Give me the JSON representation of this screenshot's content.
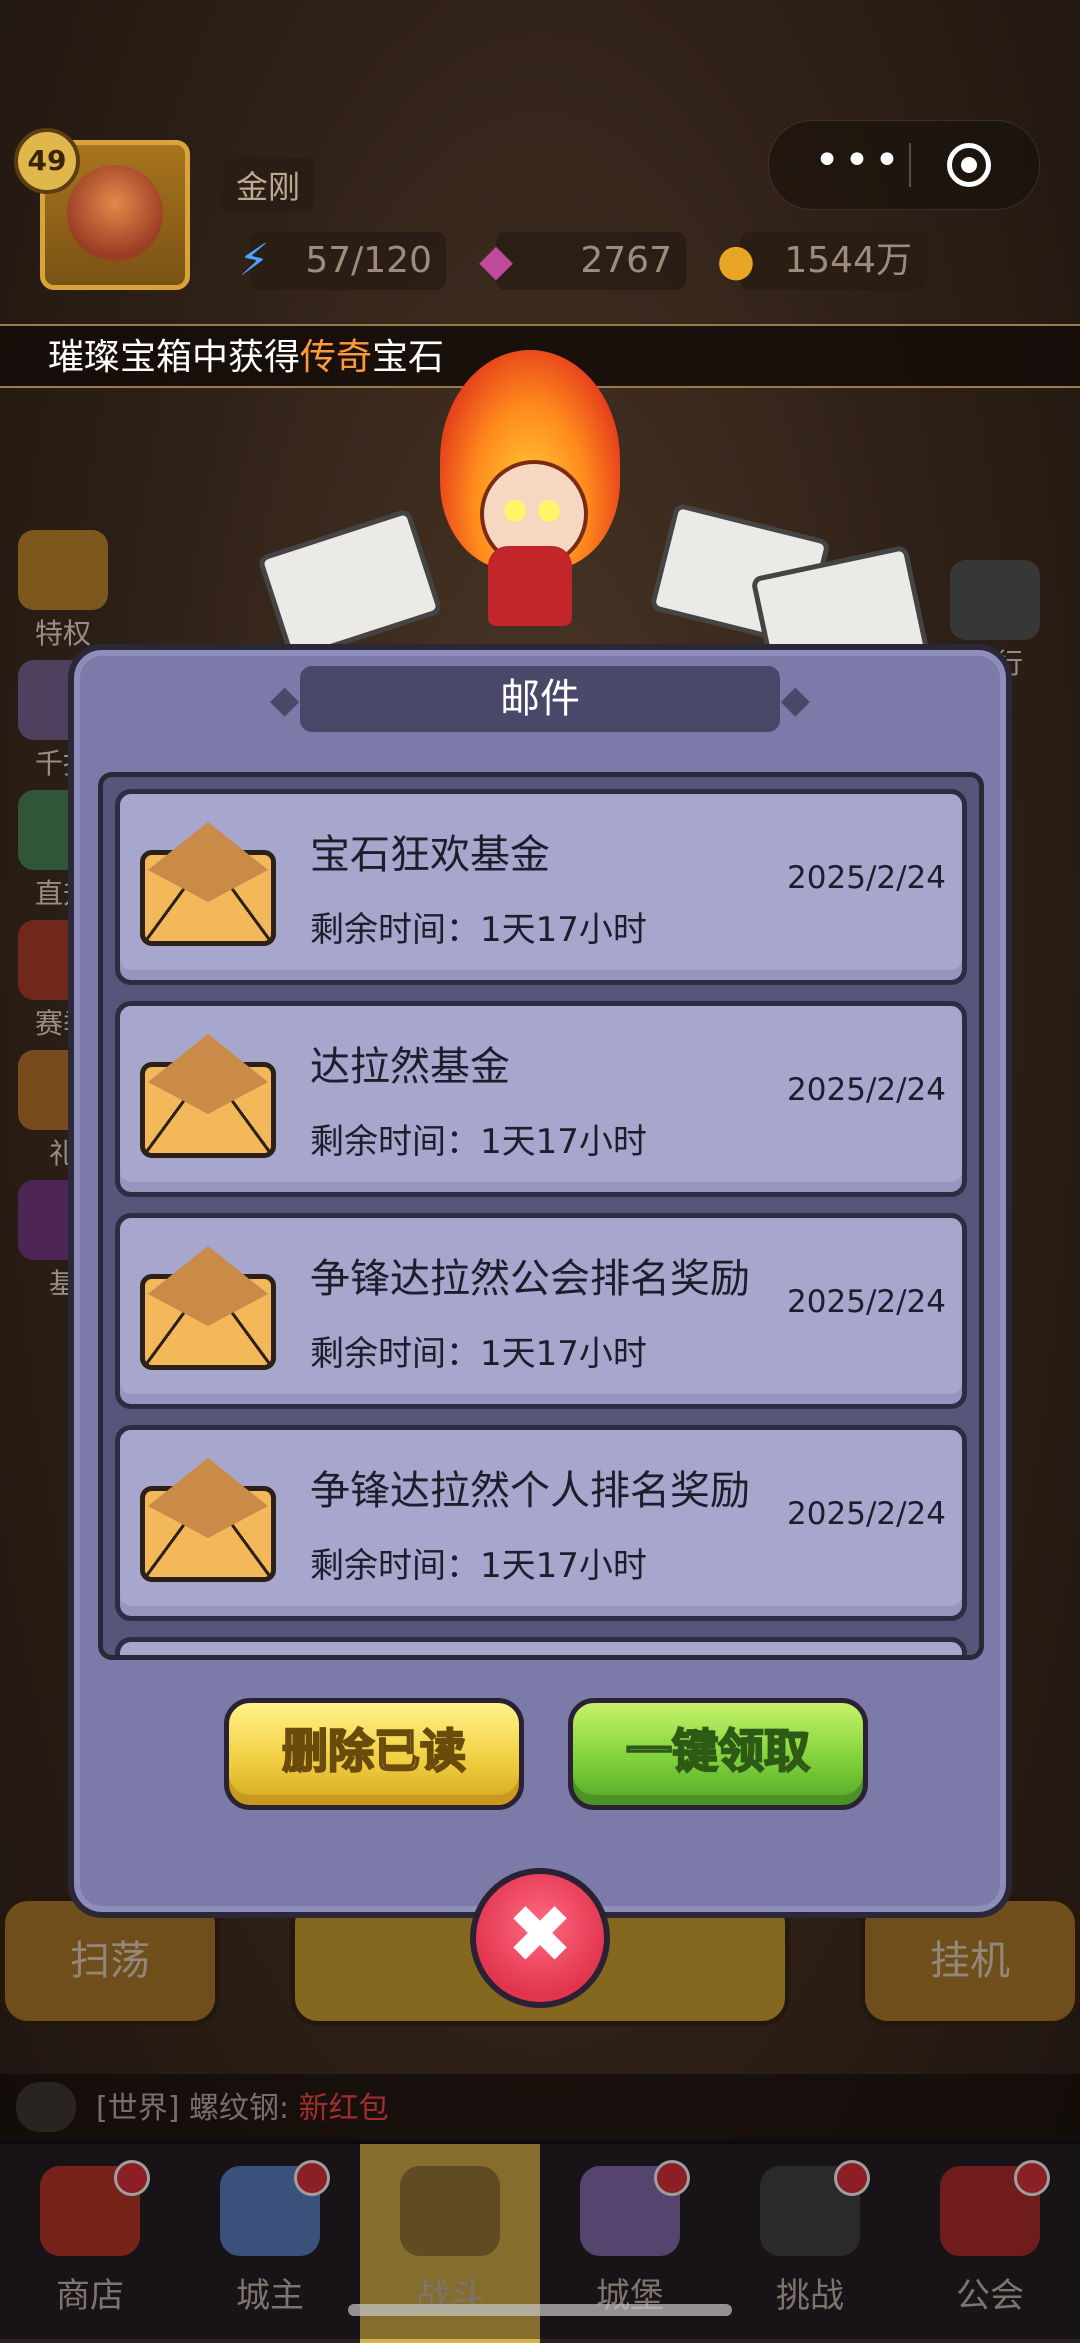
{
  "player": {
    "level": "49",
    "name": "金刚"
  },
  "resources": [
    {
      "icon": "lightning-icon",
      "value": "57/120"
    },
    {
      "icon": "gem-icon",
      "value": "2767"
    },
    {
      "icon": "coin-icon",
      "value": "1544万"
    }
  ],
  "ticker": {
    "prefix": "璀璨宝箱中获得",
    "highlight": "传奇",
    "suffix": "宝石"
  },
  "left_menu": [
    "特权",
    "千抽",
    "直升",
    "赛季",
    "礼",
    "基"
  ],
  "right_menu": [
    "排行"
  ],
  "modal": {
    "title": "邮件",
    "mails": [
      {
        "title": "宝石狂欢基金",
        "time": "剩余时间：1天17小时",
        "date": "2025/2/24"
      },
      {
        "title": "达拉然基金",
        "time": "剩余时间：1天17小时",
        "date": "2025/2/24"
      },
      {
        "title": "争锋达拉然公会排名奖励",
        "time": "剩余时间：1天17小时",
        "date": "2025/2/24"
      },
      {
        "title": "争锋达拉然个人排名奖励",
        "time": "剩余时间：1天17小时",
        "date": "2025/2/24"
      }
    ],
    "delete_read": "删除已读",
    "claim_all": "一键领取"
  },
  "bottom_left_btn": "扫荡",
  "bottom_right_btn": "挂机",
  "chat": {
    "channel": "[世界]",
    "user": "螺纹钢:",
    "message": "新红包"
  },
  "nav": [
    {
      "label": "商店",
      "icon": "shop-icon",
      "dot": true
    },
    {
      "label": "城主",
      "icon": "crown-icon",
      "dot": true
    },
    {
      "label": "战斗",
      "icon": "swords-icon",
      "dot": false,
      "active": true
    },
    {
      "label": "城堡",
      "icon": "castle-icon",
      "dot": true
    },
    {
      "label": "挑战",
      "icon": "demon-icon",
      "dot": true
    },
    {
      "label": "公会",
      "icon": "guild-icon",
      "dot": true
    }
  ],
  "colors": {
    "accent_orange": "#ff9a3a",
    "modal_bg": "#7b7aa8",
    "close_red": "#e2344f"
  }
}
